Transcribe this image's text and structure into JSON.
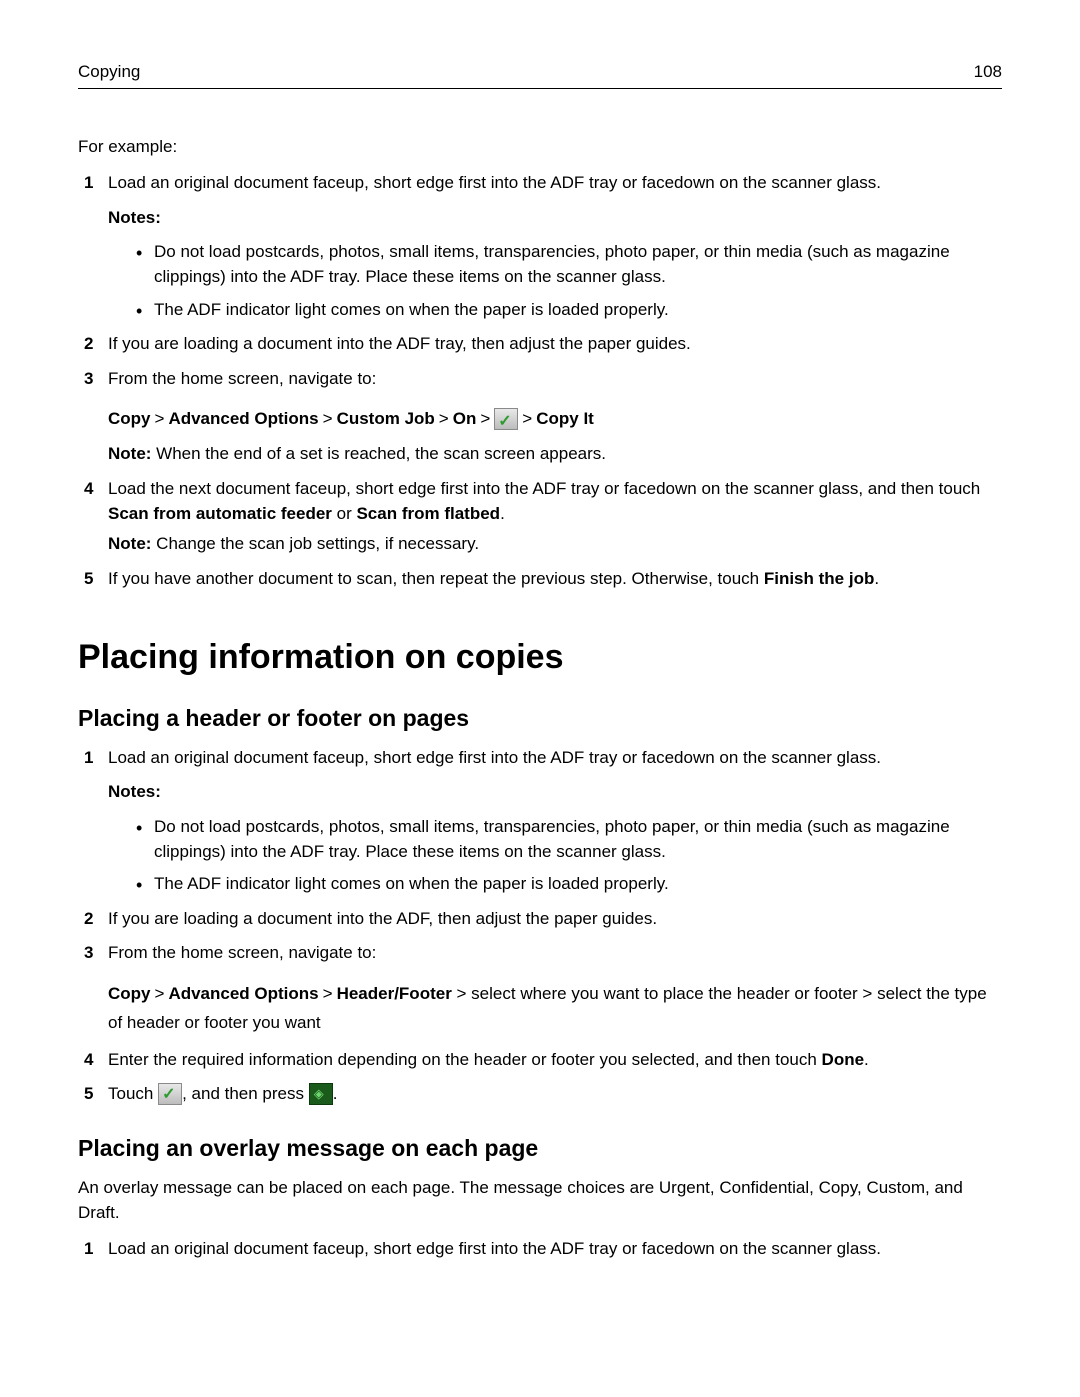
{
  "header": {
    "section": "Copying",
    "page": "108"
  },
  "intro": "For example:",
  "listA": {
    "i1": "Load an original document faceup, short edge first into the ADF tray or facedown on the scanner glass.",
    "notesLabel": "Notes:",
    "b1": "Do not load postcards, photos, small items, transparencies, photo paper, or thin media (such as magazine clippings) into the ADF tray. Place these items on the scanner glass.",
    "b2": "The ADF indicator light comes on when the paper is loaded properly.",
    "i2": "If you are loading a document into the ADF tray, then adjust the paper guides.",
    "i3": "From the home screen, navigate to:",
    "nav": {
      "copy": "Copy",
      "gt": ">",
      "adv": "Advanced Options",
      "custom": "Custom Job",
      "on": "On",
      "copyit": "Copy It"
    },
    "note3a": "Note:",
    "note3b": " When the end of a set is reached, the scan screen appears.",
    "i4a": "Load the next document faceup, short edge first into the ADF tray or facedown on the scanner glass, and then touch ",
    "i4b": "Scan from automatic feeder",
    "i4c": " or ",
    "i4d": "Scan from flatbed",
    "i4e": ".",
    "note4a": "Note:",
    "note4b": " Change the scan job settings, if necessary.",
    "i5a": "If you have another document to scan, then repeat the previous step. Otherwise, touch ",
    "i5b": "Finish the job",
    "i5c": "."
  },
  "h1": "Placing information on copies",
  "h2a": "Placing a header or footer on pages",
  "listB": {
    "i1": "Load an original document faceup, short edge first into the ADF tray or facedown on the scanner glass.",
    "notesLabel": "Notes:",
    "b1": "Do not load postcards, photos, small items, transparencies, photo paper, or thin media (such as magazine clippings) into the ADF tray. Place these items on the scanner glass.",
    "b2": "The ADF indicator light comes on when the paper is loaded properly.",
    "i2": "If you are loading a document into the ADF, then adjust the paper guides.",
    "i3": "From the home screen, navigate to:",
    "nav": {
      "copy": "Copy",
      "gt": ">",
      "adv": "Advanced Options",
      "hf": "Header/Footer",
      "rest": " > select where you want to place the header or footer > select the type of header or footer you want"
    },
    "i4a": "Enter the required information depending on the header or footer you selected, and then touch ",
    "i4b": "Done",
    "i4c": ".",
    "i5a": "Touch ",
    "i5b": ", and then press ",
    "i5c": "."
  },
  "h2b": "Placing an overlay message on each page",
  "paraB": "An overlay message can be placed on each page. The message choices are Urgent, Confidential, Copy, Custom, and Draft.",
  "listC": {
    "i1": "Load an original document faceup, short edge first into the ADF tray or facedown on the scanner glass."
  }
}
